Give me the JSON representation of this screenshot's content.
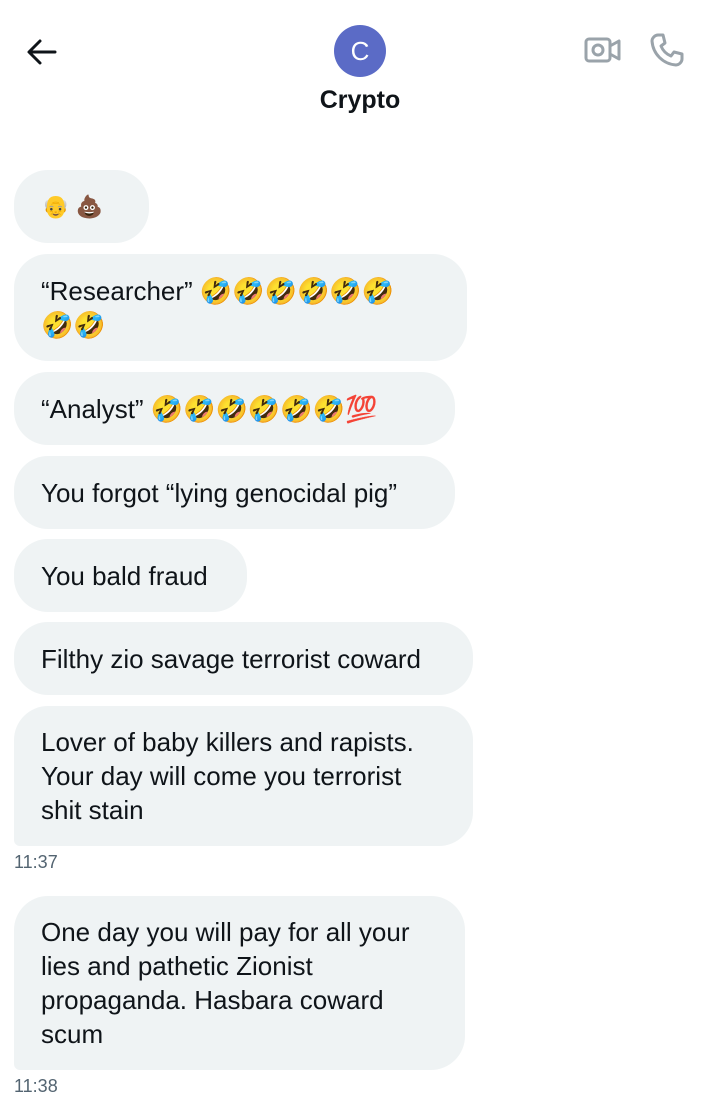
{
  "header": {
    "avatar_initial": "C",
    "contact_name": "Crypto"
  },
  "messages": [
    {
      "text": "👴 💩"
    },
    {
      "text": "“Researcher” 🤣🤣🤣🤣🤣🤣\n🤣🤣"
    },
    {
      "text": "“Analyst” 🤣🤣🤣🤣🤣🤣💯"
    },
    {
      "text": "You forgot “lying genocidal pig”"
    },
    {
      "text": "You bald fraud"
    },
    {
      "text": "Filthy zio savage terrorist coward"
    },
    {
      "text": "Lover of baby killers and rapists.\nYour day will come you terrorist\nshit stain"
    },
    {
      "text": "One day you will pay for all your\nlies and pathetic Zionist\npropaganda. Hasbara coward\nscum"
    }
  ],
  "timestamps": [
    "11:37",
    "11:38"
  ],
  "colors": {
    "bubble": "#eff3f4",
    "avatar": "#5b6bc6",
    "timestamp": "#536471",
    "icon": "#9aa3aa"
  }
}
